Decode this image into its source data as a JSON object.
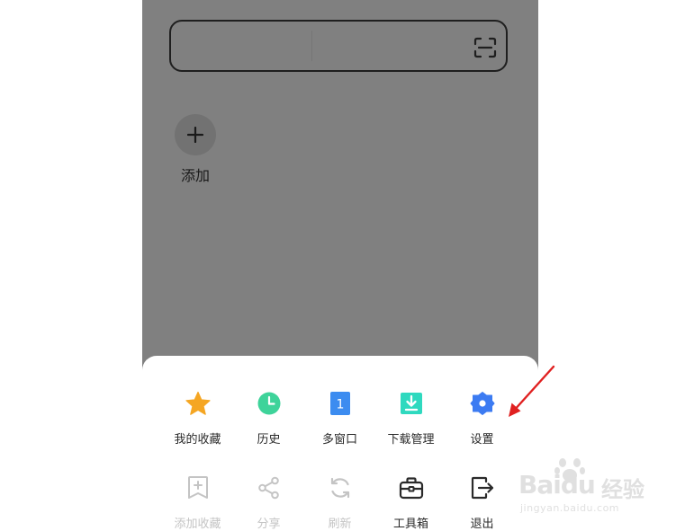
{
  "home": {
    "add_label": "添加"
  },
  "menu": {
    "row1": [
      {
        "label": "我的收藏",
        "icon": "star-icon",
        "color": "#F5A623"
      },
      {
        "label": "历史",
        "icon": "clock-icon",
        "color": "#3ED39A"
      },
      {
        "label": "多窗口",
        "icon": "window-count-icon",
        "color": "#3C8CF0",
        "count": "1"
      },
      {
        "label": "下载管理",
        "icon": "download-icon",
        "color": "#2FD9BF"
      },
      {
        "label": "设置",
        "icon": "settings-gear-icon",
        "color": "#3C7BF2"
      }
    ],
    "row2": [
      {
        "label": "添加收藏",
        "icon": "add-bookmark-icon",
        "disabled": true
      },
      {
        "label": "分享",
        "icon": "share-icon",
        "disabled": true
      },
      {
        "label": "刷新",
        "icon": "refresh-icon",
        "disabled": true
      },
      {
        "label": "工具箱",
        "icon": "toolbox-icon",
        "disabled": false
      },
      {
        "label": "退出",
        "icon": "exit-icon",
        "disabled": false
      }
    ]
  },
  "watermark": {
    "brand": "Baidu",
    "brand_cn": "经验",
    "url": "jingyan.baidu.com"
  },
  "colors": {
    "overlay": "#808080",
    "annotation_arrow": "#E02020"
  }
}
